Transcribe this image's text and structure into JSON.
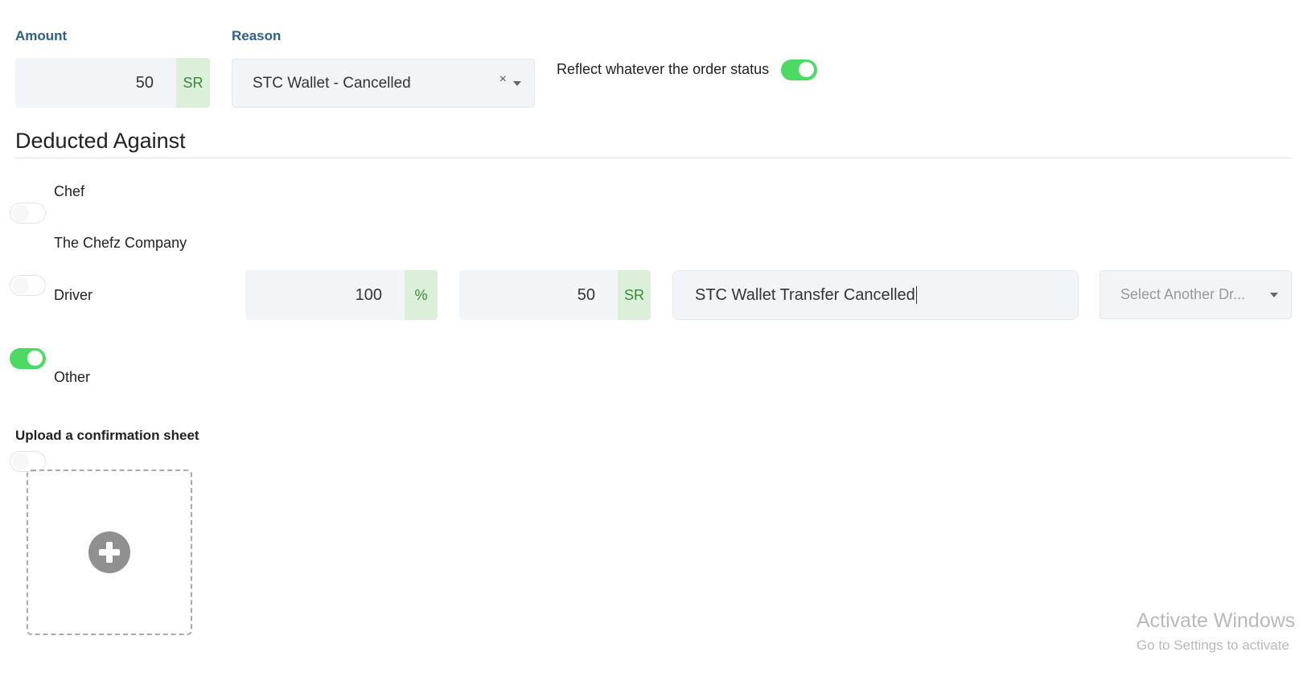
{
  "amount": {
    "label": "Amount",
    "value": "50",
    "unit": "SR"
  },
  "reason": {
    "label": "Reason",
    "value": "STC Wallet - Cancelled",
    "clear_glyph": "×"
  },
  "reflect": {
    "label": "Reflect whatever the order status",
    "on": true
  },
  "deducted": {
    "title": "Deducted Against",
    "options": [
      {
        "label": "Chef",
        "on": false
      },
      {
        "label": "The Chefz Company",
        "on": false
      },
      {
        "label": "Driver",
        "on": true
      },
      {
        "label": "Other",
        "on": false
      }
    ],
    "driver": {
      "percent_value": "100",
      "percent_unit": "%",
      "amount_value": "50",
      "amount_unit": "SR",
      "note_value": "STC Wallet Transfer Cancelled",
      "select_placeholder": "Select Another Dr..."
    }
  },
  "upload": {
    "label": "Upload a confirmation sheet"
  },
  "watermark": {
    "line1": "Activate Windows",
    "line2": "Go to Settings to activate"
  },
  "colors": {
    "accent_green": "#4cd964",
    "label_blue": "#2d5f8f",
    "unit_bg": "#dcefd8"
  }
}
